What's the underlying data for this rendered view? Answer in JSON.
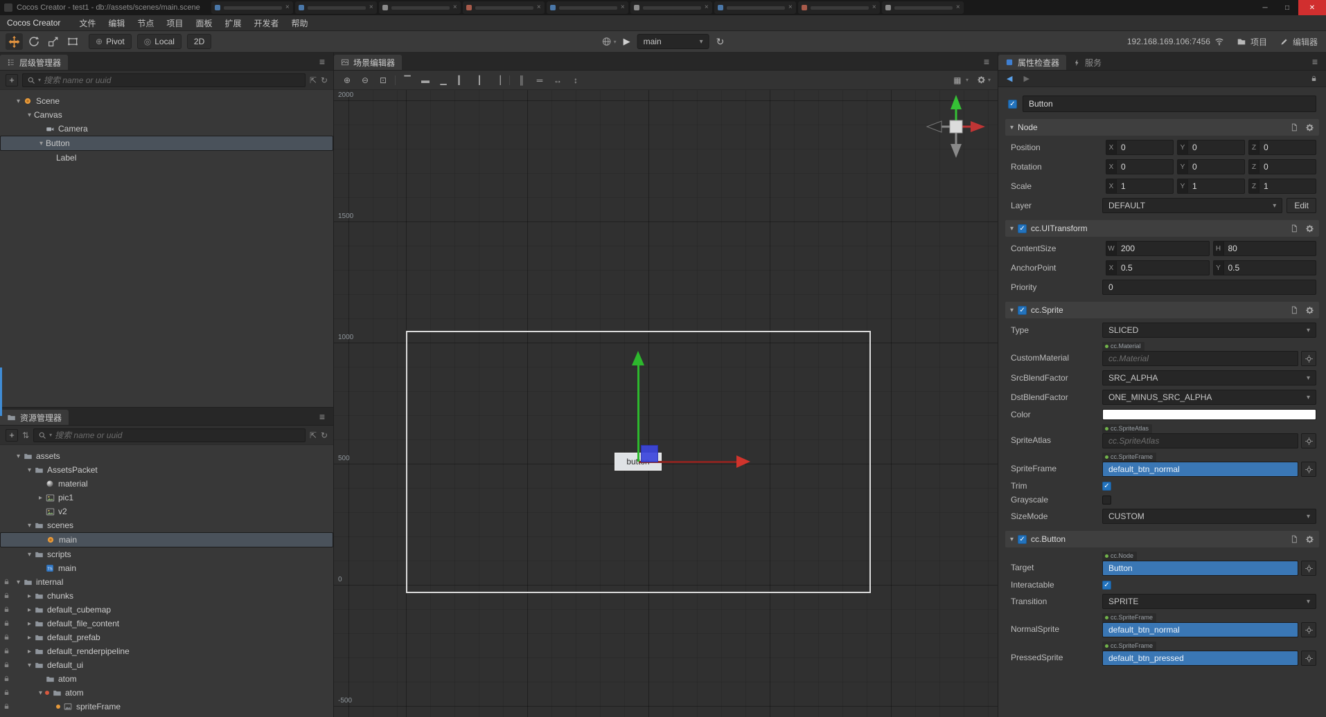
{
  "window": {
    "title": "Cocos Creator - test1 - db://assets/scenes/main.scene",
    "tab_count": 9,
    "minimize": "─",
    "maximize": "□",
    "close": "✕"
  },
  "menubar": {
    "brand": "Cocos Creator",
    "items": [
      "文件",
      "编辑",
      "节点",
      "项目",
      "面板",
      "扩展",
      "开发者",
      "帮助"
    ]
  },
  "toolbar": {
    "pivot_label": "Pivot",
    "local_label": "Local",
    "mode2d_label": "2D",
    "scene_name": "main",
    "address": "192.168.169.106:7456",
    "project_label": "项目",
    "editor_label": "编辑器"
  },
  "hierarchy": {
    "title": "层级管理器",
    "search_placeholder": "搜索 name or uuid",
    "nodes": [
      {
        "label": "Scene",
        "depth": 0,
        "arrow": "open",
        "icon": "scene",
        "selected": false
      },
      {
        "label": "Canvas",
        "depth": 1,
        "arrow": "open",
        "icon": "",
        "selected": false
      },
      {
        "label": "Camera",
        "depth": 2,
        "arrow": "none",
        "icon": "camera",
        "selected": false
      },
      {
        "label": "Button",
        "depth": 2,
        "arrow": "open",
        "icon": "",
        "selected": true
      },
      {
        "label": "Label",
        "depth": 3,
        "arrow": "none",
        "icon": "",
        "selected": false
      }
    ]
  },
  "assets": {
    "title": "资源管理器",
    "search_placeholder": "搜索 name or uuid",
    "nodes": [
      {
        "label": "assets",
        "depth": 0,
        "arrow": "open",
        "icon": "folder"
      },
      {
        "label": "AssetsPacket",
        "depth": 1,
        "arrow": "open",
        "icon": "folder"
      },
      {
        "label": "material",
        "depth": 2,
        "arrow": "none",
        "icon": "material"
      },
      {
        "label": "pic1",
        "depth": 2,
        "arrow": "closed",
        "icon": "image"
      },
      {
        "label": "v2",
        "depth": 2,
        "arrow": "none",
        "icon": "image"
      },
      {
        "label": "scenes",
        "depth": 1,
        "arrow": "open",
        "icon": "folder"
      },
      {
        "label": "main",
        "depth": 2,
        "arrow": "none",
        "icon": "scene",
        "selected": true
      },
      {
        "label": "scripts",
        "depth": 1,
        "arrow": "open",
        "icon": "folder"
      },
      {
        "label": "main",
        "depth": 2,
        "arrow": "none",
        "icon": "ts"
      },
      {
        "label": "internal",
        "depth": 0,
        "arrow": "open",
        "icon": "folder",
        "locked": true
      },
      {
        "label": "chunks",
        "depth": 1,
        "arrow": "closed",
        "icon": "folder",
        "locked": true
      },
      {
        "label": "default_cubemap",
        "depth": 1,
        "arrow": "closed",
        "icon": "folder",
        "locked": true
      },
      {
        "label": "default_file_content",
        "depth": 1,
        "arrow": "closed",
        "icon": "folder",
        "locked": true
      },
      {
        "label": "default_prefab",
        "depth": 1,
        "arrow": "closed",
        "icon": "folder",
        "locked": true
      },
      {
        "label": "default_renderpipeline",
        "depth": 1,
        "arrow": "closed",
        "icon": "folder",
        "locked": true
      },
      {
        "label": "default_ui",
        "depth": 1,
        "arrow": "open",
        "icon": "folder",
        "locked": true
      },
      {
        "label": "atom",
        "depth": 2,
        "arrow": "none",
        "icon": "folder",
        "locked": true
      },
      {
        "label": "atom",
        "depth": 2,
        "arrow": "open",
        "icon": "folder",
        "locked": true,
        "dot": "#d8593f"
      },
      {
        "label": "spriteFrame",
        "depth": 3,
        "arrow": "none",
        "icon": "spriteframe",
        "locked": true,
        "dot": "#e79a3b"
      }
    ]
  },
  "scene": {
    "title": "场景编辑器",
    "ruler_labels": [
      "2000",
      "1500",
      "1000",
      "500",
      "0",
      "-500"
    ],
    "button_label": "button",
    "toolbar_icons": [
      "zoom-in",
      "zoom-out",
      "zoom-fit",
      "|",
      "align-top",
      "align-middle",
      "align-bottom",
      "align-left",
      "align-center",
      "align-right",
      "|",
      "distribute-horizontal",
      "distribute-vertical",
      "stretch-horizontal",
      "stretch-vertical"
    ],
    "toolbar_right_icons": [
      "display-mode",
      "gizmo-settings"
    ],
    "colors": {
      "axis_x": "#d0342c",
      "axis_y": "#2db82d",
      "handle": "#3c46dd"
    }
  },
  "inspector": {
    "tab_properties": "属性检查器",
    "tab_services": "服务",
    "node_enabled": true,
    "node_name": "Button",
    "sections": [
      {
        "title": "Node",
        "has_checkbox": false,
        "rows": [
          {
            "label": "Position",
            "type": "vec",
            "axes": [
              {
                "k": "X",
                "v": "0"
              },
              {
                "k": "Y",
                "v": "0"
              },
              {
                "k": "Z",
                "v": "0"
              }
            ]
          },
          {
            "label": "Rotation",
            "type": "vec",
            "axes": [
              {
                "k": "X",
                "v": "0"
              },
              {
                "k": "Y",
                "v": "0"
              },
              {
                "k": "Z",
                "v": "0"
              }
            ]
          },
          {
            "label": "Scale",
            "type": "vec",
            "axes": [
              {
                "k": "X",
                "v": "1"
              },
              {
                "k": "Y",
                "v": "1"
              },
              {
                "k": "Z",
                "v": "1"
              }
            ]
          },
          {
            "label": "Layer",
            "type": "select",
            "value": "DEFAULT",
            "button": "Edit"
          }
        ]
      },
      {
        "title": "cc.UITransform",
        "has_checkbox": true,
        "checked": true,
        "rows": [
          {
            "label": "ContentSize",
            "type": "vec",
            "axes": [
              {
                "k": "W",
                "v": "200"
              },
              {
                "k": "H",
                "v": "80"
              }
            ]
          },
          {
            "label": "AnchorPoint",
            "type": "vec",
            "axes": [
              {
                "k": "X",
                "v": "0.5"
              },
              {
                "k": "Y",
                "v": "0.5"
              }
            ]
          },
          {
            "label": "Priority",
            "type": "input",
            "value": "0"
          }
        ]
      },
      {
        "title": "cc.Sprite",
        "has_checkbox": true,
        "checked": true,
        "rows": [
          {
            "label": "Type",
            "type": "select",
            "value": "SLICED"
          },
          {
            "label": "CustomMaterial",
            "type": "asset",
            "tag": "cc.Material",
            "value": "cc.Material",
            "filled": false
          },
          {
            "label": "SrcBlendFactor",
            "type": "select",
            "value": "SRC_ALPHA"
          },
          {
            "label": "DstBlendFactor",
            "type": "select",
            "value": "ONE_MINUS_SRC_ALPHA"
          },
          {
            "label": "Color",
            "type": "color",
            "value": "#ffffff"
          },
          {
            "label": "SpriteAtlas",
            "type": "asset",
            "tag": "cc.SpriteAtlas",
            "value": "cc.SpriteAtlas",
            "filled": false
          },
          {
            "label": "SpriteFrame",
            "type": "asset",
            "tag": "cc.SpriteFrame",
            "value": "default_btn_normal",
            "filled": true
          },
          {
            "label": "Trim",
            "type": "checkbox",
            "checked": true
          },
          {
            "label": "Grayscale",
            "type": "checkbox",
            "checked": false
          },
          {
            "label": "SizeMode",
            "type": "select",
            "value": "CUSTOM"
          }
        ]
      },
      {
        "title": "cc.Button",
        "has_checkbox": true,
        "checked": true,
        "rows": [
          {
            "label": "Target",
            "type": "asset",
            "tag": "cc.Node",
            "value": "Button",
            "filled": true
          },
          {
            "label": "Interactable",
            "type": "checkbox",
            "checked": true
          },
          {
            "label": "Transition",
            "type": "select",
            "value": "SPRITE"
          },
          {
            "label": "NormalSprite",
            "type": "asset",
            "tag": "cc.SpriteFrame",
            "value": "default_btn_normal",
            "filled": true
          },
          {
            "label": "PressedSprite",
            "type": "asset",
            "tag": "cc.SpriteFrame",
            "value": "default_btn_pressed",
            "filled": true
          }
        ]
      }
    ]
  }
}
